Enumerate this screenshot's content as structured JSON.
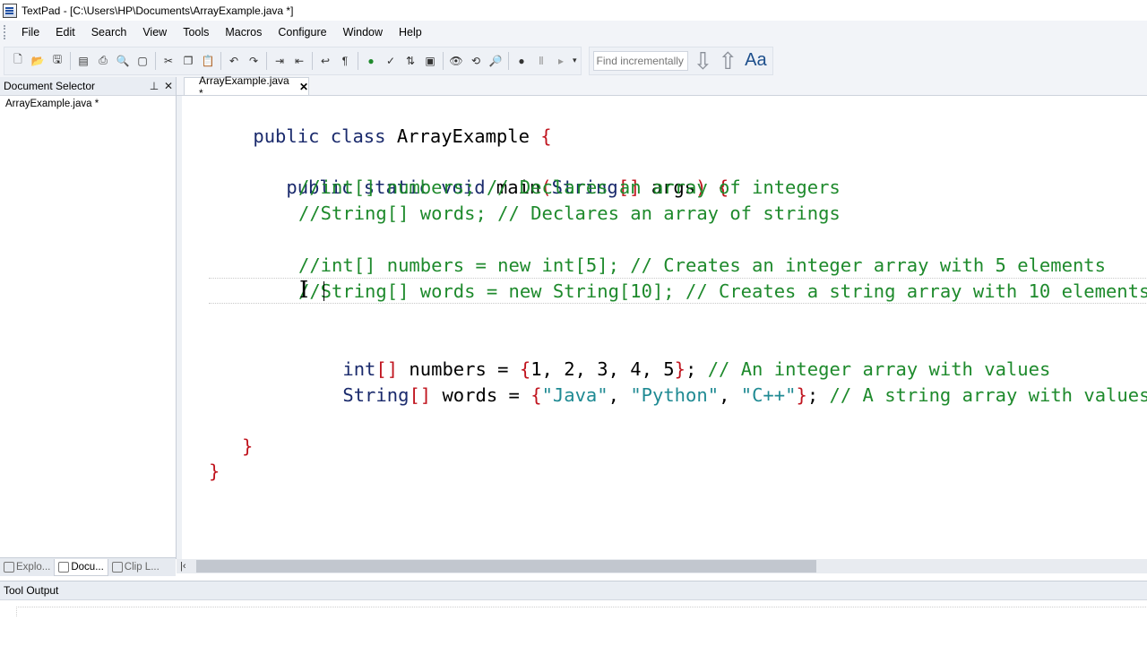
{
  "window": {
    "title": "TextPad - [C:\\Users\\HP\\Documents\\ArrayExample.java *]"
  },
  "menu": [
    "File",
    "Edit",
    "Search",
    "View",
    "Tools",
    "Macros",
    "Configure",
    "Window",
    "Help"
  ],
  "find": {
    "placeholder": "Find incrementally",
    "case_label": "Aa"
  },
  "doc_selector": {
    "title": "Document Selector",
    "files": [
      "ArrayExample.java *"
    ],
    "tabs": [
      "Explo...",
      "Docu...",
      "Clip L..."
    ]
  },
  "editor": {
    "tab_label": "ArrayExample.java *",
    "code": {
      "l1": [
        "public",
        " ",
        "class",
        " ArrayExample ",
        "{"
      ],
      "l2": [
        "public",
        " ",
        "static",
        " ",
        "void",
        " main",
        "(",
        "String",
        "[]",
        " args",
        ")",
        " ",
        "{"
      ],
      "l3": "//int[] numbers; // Declares an array of integers",
      "l4": "//String[] words; // Declares an array of strings",
      "l5": "//int[] numbers = new int[5]; // Creates an integer array with 5 elements",
      "l6": "//String[] words = new String[10]; // Creates a string array with 10 elements",
      "l7": [
        "int",
        "[]",
        " numbers = ",
        "{",
        "1, 2, 3, 4, 5",
        "}",
        "; ",
        "// An integer array with values"
      ],
      "l8": [
        "String",
        "[]",
        " words = ",
        "{",
        "\"Java\"",
        ", ",
        "\"Python\"",
        ", ",
        "\"C++\"",
        "}",
        "; ",
        "// A string array with values"
      ],
      "l9": "}",
      "l10": "}"
    }
  },
  "tool_output": {
    "title": "Tool Output"
  },
  "colors": {
    "keyword": "#1a2a6c",
    "comment": "#1e8a2c",
    "bracket": "#c0141e",
    "string": "#1f8a93"
  }
}
